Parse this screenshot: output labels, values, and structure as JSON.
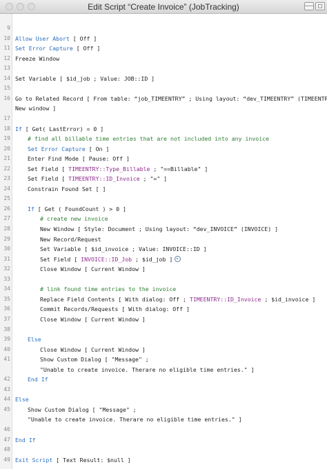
{
  "window": {
    "title": "Edit Script “Create Invoice” (JobTracking)"
  },
  "lines": [
    {
      "n": "9",
      "parts": []
    },
    {
      "n": "10",
      "parts": [
        {
          "t": "Allow User Abort",
          "c": "kw"
        },
        {
          "t": " [ Off ]"
        }
      ]
    },
    {
      "n": "11",
      "parts": [
        {
          "t": "Set Error Capture",
          "c": "kw"
        },
        {
          "t": " [ Off ]"
        }
      ]
    },
    {
      "n": "12",
      "parts": [
        {
          "t": "Freeze Window"
        }
      ]
    },
    {
      "n": "13",
      "parts": []
    },
    {
      "n": "14",
      "parts": [
        {
          "t": "Set Variable [ $id_job ; Value: JOB::ID ]"
        }
      ]
    },
    {
      "n": "15",
      "parts": []
    },
    {
      "n": "16",
      "parts": [
        {
          "t": "Go to Related Record [ From table: “job_TIMEENTRY” ; Using layout: “dev_TIMEENTRY” (TIMEENTRY) ;"
        }
      ]
    },
    {
      "n": "",
      "parts": [
        {
          "t": "New window ]"
        }
      ]
    },
    {
      "n": "17",
      "parts": []
    },
    {
      "n": "18",
      "parts": [
        {
          "t": "If",
          "c": "kw"
        },
        {
          "t": " [ Get( LastError) = 0 ]"
        }
      ]
    },
    {
      "n": "19",
      "indent": 1,
      "parts": [
        {
          "t": "# find all billable time entries that are not included into any invoice",
          "c": "cm"
        }
      ]
    },
    {
      "n": "20",
      "indent": 1,
      "parts": [
        {
          "t": "Set Error Capture",
          "c": "kw"
        },
        {
          "t": " [ On ]"
        }
      ]
    },
    {
      "n": "21",
      "indent": 1,
      "parts": [
        {
          "t": "Enter Find Mode [ Pause: Off ]"
        }
      ]
    },
    {
      "n": "22",
      "indent": 1,
      "parts": [
        {
          "t": "Set Field [ "
        },
        {
          "t": "TIMEENTRY::Type_Billable",
          "c": "fld"
        },
        {
          "t": " ; \"==Billable\" ]"
        }
      ]
    },
    {
      "n": "23",
      "indent": 1,
      "parts": [
        {
          "t": "Set Field [ "
        },
        {
          "t": "TIMEENTRY::ID_Invoice",
          "c": "fld"
        },
        {
          "t": " ; \"=\" ]"
        }
      ]
    },
    {
      "n": "24",
      "indent": 1,
      "parts": [
        {
          "t": "Constrain Found Set [ ]"
        }
      ]
    },
    {
      "n": "25",
      "parts": []
    },
    {
      "n": "26",
      "indent": 1,
      "parts": [
        {
          "t": "If",
          "c": "kw"
        },
        {
          "t": " [ Get ( FoundCount ) > 0 ]"
        }
      ]
    },
    {
      "n": "27",
      "indent": 2,
      "parts": [
        {
          "t": "# create new invoice",
          "c": "cm"
        }
      ]
    },
    {
      "n": "28",
      "indent": 2,
      "parts": [
        {
          "t": "New Window [ Style: Document ; Using layout: “dev_INVOICE” (INVOICE) ]"
        }
      ]
    },
    {
      "n": "29",
      "indent": 2,
      "parts": [
        {
          "t": "New Record/Request"
        }
      ]
    },
    {
      "n": "30",
      "indent": 2,
      "parts": [
        {
          "t": "Set Variable [ $id_invoice ; Value: INVOICE::ID ]"
        }
      ]
    },
    {
      "n": "31",
      "indent": 2,
      "gear": true,
      "parts": [
        {
          "t": "Set Field [ "
        },
        {
          "t": "INVOICE::ID_Job",
          "c": "fld"
        },
        {
          "t": " ; $id_job ]"
        }
      ]
    },
    {
      "n": "32",
      "indent": 2,
      "parts": [
        {
          "t": "Close Window [ Current Window ]"
        }
      ]
    },
    {
      "n": "33",
      "parts": []
    },
    {
      "n": "34",
      "indent": 2,
      "parts": [
        {
          "t": "# link found time entries to the invoice",
          "c": "cm"
        }
      ]
    },
    {
      "n": "35",
      "indent": 2,
      "parts": [
        {
          "t": "Replace Field Contents [ With dialog: Off ; "
        },
        {
          "t": "TIMEENTRY::ID_Invoice",
          "c": "fld"
        },
        {
          "t": " ; $id_invoice ]"
        }
      ]
    },
    {
      "n": "36",
      "indent": 2,
      "parts": [
        {
          "t": "Commit Records/Requests [ With dialog: Off ]"
        }
      ]
    },
    {
      "n": "37",
      "indent": 2,
      "parts": [
        {
          "t": "Close Window [ Current Window ]"
        }
      ]
    },
    {
      "n": "38",
      "parts": []
    },
    {
      "n": "39",
      "indent": 1,
      "parts": [
        {
          "t": "Else",
          "c": "kw"
        }
      ]
    },
    {
      "n": "40",
      "indent": 2,
      "parts": [
        {
          "t": "Close Window [ Current Window ]"
        }
      ]
    },
    {
      "n": "41",
      "indent": 2,
      "parts": [
        {
          "t": "Show Custom Dialog [ \"Message\" ;"
        }
      ]
    },
    {
      "n": "",
      "indent": 2,
      "parts": [
        {
          "t": "\"Unable to create invoice. Therare no eligible time entries.\" ]"
        }
      ]
    },
    {
      "n": "42",
      "indent": 1,
      "parts": [
        {
          "t": "End If",
          "c": "kw"
        }
      ]
    },
    {
      "n": "43",
      "parts": []
    },
    {
      "n": "44",
      "parts": [
        {
          "t": "Else",
          "c": "kw"
        }
      ]
    },
    {
      "n": "45",
      "indent": 1,
      "parts": [
        {
          "t": "Show Custom Dialog [ \"Message\" ;"
        }
      ]
    },
    {
      "n": "",
      "indent": 1,
      "parts": [
        {
          "t": "\"Unable to create invoice. Therare no eligible time entries.\" ]"
        }
      ]
    },
    {
      "n": "46",
      "parts": []
    },
    {
      "n": "47",
      "parts": [
        {
          "t": "End If",
          "c": "kw"
        }
      ]
    },
    {
      "n": "48",
      "parts": []
    },
    {
      "n": "49",
      "parts": [
        {
          "t": "Exit Script",
          "c": "kw"
        },
        {
          "t": " [ Text Result: $null ]"
        }
      ]
    }
  ]
}
